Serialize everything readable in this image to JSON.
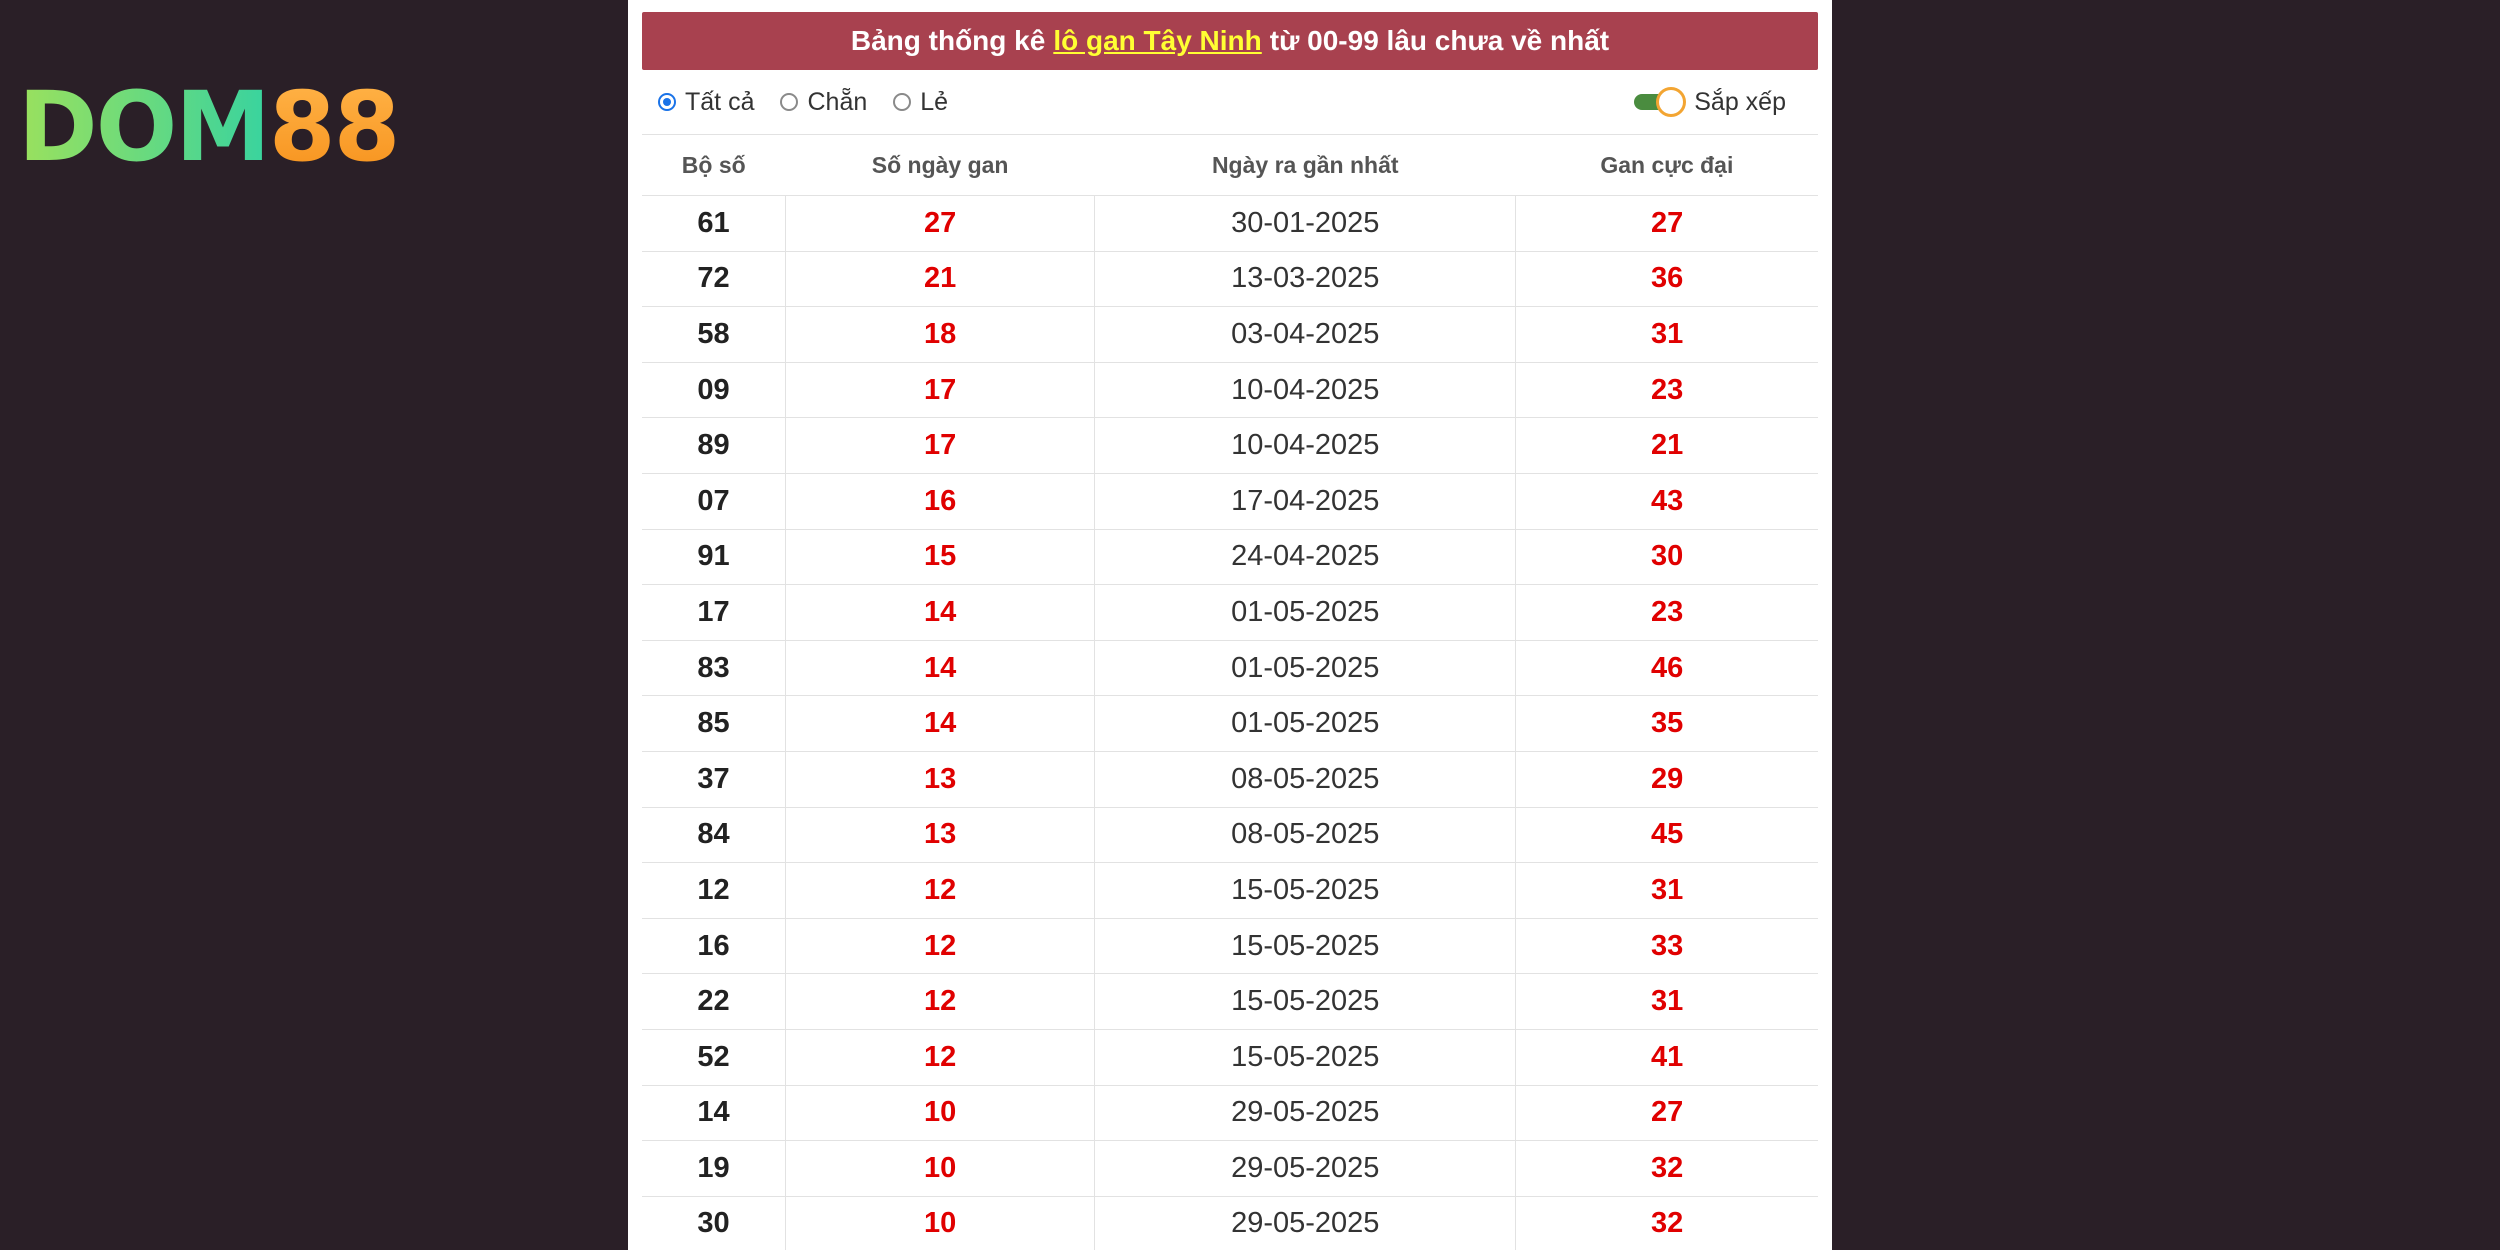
{
  "logo": {
    "part1": "DOM",
    "part2": "88"
  },
  "title": {
    "prefix": "Bảng thống kê",
    "highlight": "lô gan Tây Ninh",
    "suffix": "từ 00-99 lâu chưa về nhất"
  },
  "filters": {
    "options": [
      {
        "label": "Tất cả",
        "checked": true
      },
      {
        "label": "Chẵn",
        "checked": false
      },
      {
        "label": "Lẻ",
        "checked": false
      }
    ],
    "sort_label": "Sắp xếp",
    "sort_on": true
  },
  "table": {
    "headers": [
      "Bộ số",
      "Số ngày gan",
      "Ngày ra gần nhất",
      "Gan cực đại"
    ],
    "rows": [
      [
        "61",
        "27",
        "30-01-2025",
        "27"
      ],
      [
        "72",
        "21",
        "13-03-2025",
        "36"
      ],
      [
        "58",
        "18",
        "03-04-2025",
        "31"
      ],
      [
        "09",
        "17",
        "10-04-2025",
        "23"
      ],
      [
        "89",
        "17",
        "10-04-2025",
        "21"
      ],
      [
        "07",
        "16",
        "17-04-2025",
        "43"
      ],
      [
        "91",
        "15",
        "24-04-2025",
        "30"
      ],
      [
        "17",
        "14",
        "01-05-2025",
        "23"
      ],
      [
        "83",
        "14",
        "01-05-2025",
        "46"
      ],
      [
        "85",
        "14",
        "01-05-2025",
        "35"
      ],
      [
        "37",
        "13",
        "08-05-2025",
        "29"
      ],
      [
        "84",
        "13",
        "08-05-2025",
        "45"
      ],
      [
        "12",
        "12",
        "15-05-2025",
        "31"
      ],
      [
        "16",
        "12",
        "15-05-2025",
        "33"
      ],
      [
        "22",
        "12",
        "15-05-2025",
        "31"
      ],
      [
        "52",
        "12",
        "15-05-2025",
        "41"
      ],
      [
        "14",
        "10",
        "29-05-2025",
        "27"
      ],
      [
        "19",
        "10",
        "29-05-2025",
        "32"
      ],
      [
        "30",
        "10",
        "29-05-2025",
        "32"
      ]
    ]
  },
  "colors": {
    "title_bg": "#a8414f",
    "highlight": "#ffff33",
    "value_red": "#e00000",
    "page_bg": "#2a1f27"
  }
}
